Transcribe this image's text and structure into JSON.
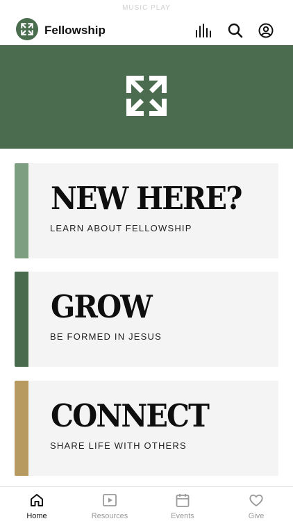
{
  "status_bar": {
    "text": "MUSIC PLAY"
  },
  "header": {
    "title": "Fellowship"
  },
  "cards": [
    {
      "title": "NEW HERE?",
      "subtitle": "LEARN ABOUT FELLOWSHIP",
      "accent": "#7d9e80"
    },
    {
      "title": "GROW",
      "subtitle": "BE FORMED IN JESUS",
      "accent": "#496a4d"
    },
    {
      "title": "CONNECT",
      "subtitle": "SHARE LIFE WITH OTHERS",
      "accent": "#b79a5f"
    }
  ],
  "tabs": [
    {
      "label": "Home",
      "icon": "home-icon",
      "active": true
    },
    {
      "label": "Resources",
      "icon": "play-square-icon",
      "active": false
    },
    {
      "label": "Events",
      "icon": "calendar-icon",
      "active": false
    },
    {
      "label": "Give",
      "icon": "heart-icon",
      "active": false
    }
  ],
  "colors": {
    "brand_green": "#4b6c4f",
    "card_bg": "#f4f4f4",
    "active_tab": "#111111",
    "inactive_tab": "#9a9a9a"
  }
}
